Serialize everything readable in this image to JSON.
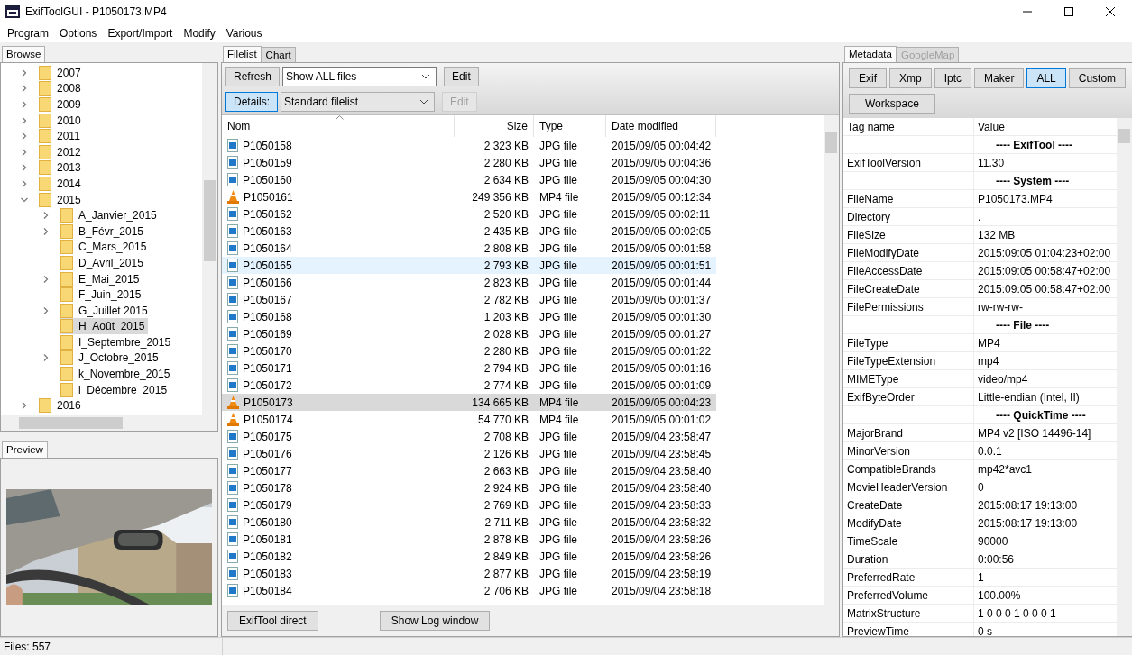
{
  "window": {
    "title": "ExifToolGUI - P1050173.MP4"
  },
  "menu": [
    "Program",
    "Options",
    "Export/Import",
    "Modify",
    "Various"
  ],
  "browse": {
    "tabs": [
      {
        "label": "Browse",
        "selected": true
      }
    ],
    "tree": [
      {
        "label": "2007",
        "expandable": true,
        "expanded": false,
        "selected": false
      },
      {
        "label": "2008",
        "expandable": true,
        "expanded": false,
        "selected": false
      },
      {
        "label": "2009",
        "expandable": true,
        "expanded": false,
        "selected": false
      },
      {
        "label": "2010",
        "expandable": true,
        "expanded": false,
        "selected": false
      },
      {
        "label": "2011",
        "expandable": true,
        "expanded": false,
        "selected": false
      },
      {
        "label": "2012",
        "expandable": true,
        "expanded": false,
        "selected": false
      },
      {
        "label": "2013",
        "expandable": true,
        "expanded": false,
        "selected": false
      },
      {
        "label": "2014",
        "expandable": true,
        "expanded": false,
        "selected": false
      },
      {
        "label": "2015",
        "expandable": true,
        "expanded": true,
        "selected": false,
        "children": [
          {
            "label": "A_Janvier_2015",
            "expandable": true,
            "expanded": false,
            "selected": false
          },
          {
            "label": "B_Févr_2015",
            "expandable": true,
            "expanded": false,
            "selected": false
          },
          {
            "label": "C_Mars_2015",
            "expandable": false,
            "expanded": false,
            "selected": false
          },
          {
            "label": "D_Avril_2015",
            "expandable": false,
            "expanded": false,
            "selected": false
          },
          {
            "label": "E_Mai_2015",
            "expandable": true,
            "expanded": false,
            "selected": false
          },
          {
            "label": "F_Juin_2015",
            "expandable": false,
            "expanded": false,
            "selected": false
          },
          {
            "label": "G_Juillet 2015",
            "expandable": true,
            "expanded": false,
            "selected": false
          },
          {
            "label": "H_Août_2015",
            "expandable": false,
            "expanded": false,
            "selected": true
          },
          {
            "label": "I_Septembre_2015",
            "expandable": false,
            "expanded": false,
            "selected": false
          },
          {
            "label": "J_Octobre_2015",
            "expandable": true,
            "expanded": false,
            "selected": false
          },
          {
            "label": "k_Novembre_2015",
            "expandable": false,
            "expanded": false,
            "selected": false
          },
          {
            "label": "l_Décembre_2015",
            "expandable": false,
            "expanded": false,
            "selected": false
          }
        ]
      },
      {
        "label": "2016",
        "expandable": true,
        "expanded": false,
        "selected": false
      }
    ]
  },
  "preview": {
    "tabs": [
      {
        "label": "Preview",
        "selected": true
      }
    ],
    "kind": "picture"
  },
  "filelist": {
    "tabs": [
      {
        "label": "Filelist",
        "selected": true
      },
      {
        "label": "Chart",
        "selected": false
      }
    ],
    "refresh": "Refresh",
    "filter": "Show ALL files",
    "edit1": {
      "label": "Edit",
      "disabled": false
    },
    "details": {
      "label": "Details:",
      "active": true
    },
    "view": "Standard filelist",
    "edit2": {
      "label": "Edit",
      "disabled": true
    },
    "columns": [
      "Nom",
      "Size",
      "Type",
      "Date modified"
    ],
    "rows": [
      {
        "name": "P1050158",
        "size": "2 323 KB",
        "type": "JPG file",
        "date": "2015/09/05 00:04:42",
        "kind": "jpg",
        "selected": false,
        "hovered": false
      },
      {
        "name": "P1050159",
        "size": "2 280 KB",
        "type": "JPG file",
        "date": "2015/09/05 00:04:36",
        "kind": "jpg",
        "selected": false,
        "hovered": false
      },
      {
        "name": "P1050160",
        "size": "2 634 KB",
        "type": "JPG file",
        "date": "2015/09/05 00:04:30",
        "kind": "jpg",
        "selected": false,
        "hovered": false
      },
      {
        "name": "P1050161",
        "size": "249 356 KB",
        "type": "MP4 file",
        "date": "2015/09/05 00:12:34",
        "kind": "mp4",
        "selected": false,
        "hovered": false
      },
      {
        "name": "P1050162",
        "size": "2 520 KB",
        "type": "JPG file",
        "date": "2015/09/05 00:02:11",
        "kind": "jpg",
        "selected": false,
        "hovered": false
      },
      {
        "name": "P1050163",
        "size": "2 435 KB",
        "type": "JPG file",
        "date": "2015/09/05 00:02:05",
        "kind": "jpg",
        "selected": false,
        "hovered": false
      },
      {
        "name": "P1050164",
        "size": "2 808 KB",
        "type": "JPG file",
        "date": "2015/09/05 00:01:58",
        "kind": "jpg",
        "selected": false,
        "hovered": false
      },
      {
        "name": "P1050165",
        "size": "2 793 KB",
        "type": "JPG file",
        "date": "2015/09/05 00:01:51",
        "kind": "jpg",
        "selected": false,
        "hovered": true
      },
      {
        "name": "P1050166",
        "size": "2 823 KB",
        "type": "JPG file",
        "date": "2015/09/05 00:01:44",
        "kind": "jpg",
        "selected": false,
        "hovered": false
      },
      {
        "name": "P1050167",
        "size": "2 782 KB",
        "type": "JPG file",
        "date": "2015/09/05 00:01:37",
        "kind": "jpg",
        "selected": false,
        "hovered": false
      },
      {
        "name": "P1050168",
        "size": "1 203 KB",
        "type": "JPG file",
        "date": "2015/09/05 00:01:30",
        "kind": "jpg",
        "selected": false,
        "hovered": false
      },
      {
        "name": "P1050169",
        "size": "2 028 KB",
        "type": "JPG file",
        "date": "2015/09/05 00:01:27",
        "kind": "jpg",
        "selected": false,
        "hovered": false
      },
      {
        "name": "P1050170",
        "size": "2 280 KB",
        "type": "JPG file",
        "date": "2015/09/05 00:01:22",
        "kind": "jpg",
        "selected": false,
        "hovered": false
      },
      {
        "name": "P1050171",
        "size": "2 794 KB",
        "type": "JPG file",
        "date": "2015/09/05 00:01:16",
        "kind": "jpg",
        "selected": false,
        "hovered": false
      },
      {
        "name": "P1050172",
        "size": "2 774 KB",
        "type": "JPG file",
        "date": "2015/09/05 00:01:09",
        "kind": "jpg",
        "selected": false,
        "hovered": false
      },
      {
        "name": "P1050173",
        "size": "134 665 KB",
        "type": "MP4 file",
        "date": "2015/09/05 00:04:23",
        "kind": "mp4",
        "selected": true,
        "hovered": false
      },
      {
        "name": "P1050174",
        "size": "54 770 KB",
        "type": "MP4 file",
        "date": "2015/09/05 00:01:02",
        "kind": "mp4",
        "selected": false,
        "hovered": false
      },
      {
        "name": "P1050175",
        "size": "2 708 KB",
        "type": "JPG file",
        "date": "2015/09/04 23:58:47",
        "kind": "jpg",
        "selected": false,
        "hovered": false
      },
      {
        "name": "P1050176",
        "size": "2 126 KB",
        "type": "JPG file",
        "date": "2015/09/04 23:58:45",
        "kind": "jpg",
        "selected": false,
        "hovered": false
      },
      {
        "name": "P1050177",
        "size": "2 663 KB",
        "type": "JPG file",
        "date": "2015/09/04 23:58:40",
        "kind": "jpg",
        "selected": false,
        "hovered": false
      },
      {
        "name": "P1050178",
        "size": "2 924 KB",
        "type": "JPG file",
        "date": "2015/09/04 23:58:40",
        "kind": "jpg",
        "selected": false,
        "hovered": false
      },
      {
        "name": "P1050179",
        "size": "2 769 KB",
        "type": "JPG file",
        "date": "2015/09/04 23:58:33",
        "kind": "jpg",
        "selected": false,
        "hovered": false
      },
      {
        "name": "P1050180",
        "size": "2 711 KB",
        "type": "JPG file",
        "date": "2015/09/04 23:58:32",
        "kind": "jpg",
        "selected": false,
        "hovered": false
      },
      {
        "name": "P1050181",
        "size": "2 878 KB",
        "type": "JPG file",
        "date": "2015/09/04 23:58:26",
        "kind": "jpg",
        "selected": false,
        "hovered": false
      },
      {
        "name": "P1050182",
        "size": "2 849 KB",
        "type": "JPG file",
        "date": "2015/09/04 23:58:26",
        "kind": "jpg",
        "selected": false,
        "hovered": false
      },
      {
        "name": "P1050183",
        "size": "2 877 KB",
        "type": "JPG file",
        "date": "2015/09/04 23:58:19",
        "kind": "jpg",
        "selected": false,
        "hovered": false
      },
      {
        "name": "P1050184",
        "size": "2 706 KB",
        "type": "JPG file",
        "date": "2015/09/04 23:58:18",
        "kind": "jpg",
        "selected": false,
        "hovered": false
      }
    ],
    "bottom_buttons": [
      "ExifTool direct",
      "Show Log window"
    ]
  },
  "metadata": {
    "tabs": [
      {
        "label": "Metadata",
        "selected": true,
        "disabled": false
      },
      {
        "label": "GoogleMap",
        "selected": false,
        "disabled": true
      }
    ],
    "filters": [
      {
        "label": "Exif",
        "selected": false
      },
      {
        "label": "Xmp",
        "selected": false
      },
      {
        "label": "Iptc",
        "selected": false
      },
      {
        "label": "Maker",
        "selected": false
      },
      {
        "label": "ALL",
        "selected": true
      },
      {
        "label": "Custom",
        "selected": false
      }
    ],
    "workspace": "Workspace",
    "columns": [
      "Tag name",
      "Value"
    ],
    "rows": [
      {
        "kind": "section",
        "value": "---- ExifTool ----"
      },
      {
        "kind": "tag",
        "tag": "ExifToolVersion",
        "value": "11.30"
      },
      {
        "kind": "section",
        "value": "---- System ----"
      },
      {
        "kind": "tag",
        "tag": "FileName",
        "value": "P1050173.MP4"
      },
      {
        "kind": "tag",
        "tag": "Directory",
        "value": "."
      },
      {
        "kind": "tag",
        "tag": "FileSize",
        "value": "132 MB"
      },
      {
        "kind": "tag",
        "tag": "FileModifyDate",
        "value": "2015:09:05 01:04:23+02:00"
      },
      {
        "kind": "tag",
        "tag": "FileAccessDate",
        "value": "2015:09:05 00:58:47+02:00"
      },
      {
        "kind": "tag",
        "tag": "FileCreateDate",
        "value": "2015:09:05 00:58:47+02:00"
      },
      {
        "kind": "tag",
        "tag": "FilePermissions",
        "value": "rw-rw-rw-"
      },
      {
        "kind": "section",
        "value": "---- File ----"
      },
      {
        "kind": "tag",
        "tag": "FileType",
        "value": "MP4"
      },
      {
        "kind": "tag",
        "tag": "FileTypeExtension",
        "value": "mp4"
      },
      {
        "kind": "tag",
        "tag": "MIMEType",
        "value": "video/mp4"
      },
      {
        "kind": "tag",
        "tag": "ExifByteOrder",
        "value": "Little-endian (Intel, II)"
      },
      {
        "kind": "section",
        "value": "---- QuickTime ----"
      },
      {
        "kind": "tag",
        "tag": "MajorBrand",
        "value": "MP4 v2 [ISO 14496-14]"
      },
      {
        "kind": "tag",
        "tag": "MinorVersion",
        "value": "0.0.1"
      },
      {
        "kind": "tag",
        "tag": "CompatibleBrands",
        "value": "mp42*avc1"
      },
      {
        "kind": "tag",
        "tag": "MovieHeaderVersion",
        "value": "0"
      },
      {
        "kind": "tag",
        "tag": "CreateDate",
        "value": "2015:08:17 19:13:00"
      },
      {
        "kind": "tag",
        "tag": "ModifyDate",
        "value": "2015:08:17 19:13:00"
      },
      {
        "kind": "tag",
        "tag": "TimeScale",
        "value": "90000"
      },
      {
        "kind": "tag",
        "tag": "Duration",
        "value": "0:00:56"
      },
      {
        "kind": "tag",
        "tag": "PreferredRate",
        "value": "1"
      },
      {
        "kind": "tag",
        "tag": "PreferredVolume",
        "value": "100.00%"
      },
      {
        "kind": "tag",
        "tag": "MatrixStructure",
        "value": "1 0 0 0 1 0 0 0 1"
      },
      {
        "kind": "tag",
        "tag": "PreviewTime",
        "value": "0 s"
      }
    ]
  },
  "status_bar": "Files: 557"
}
